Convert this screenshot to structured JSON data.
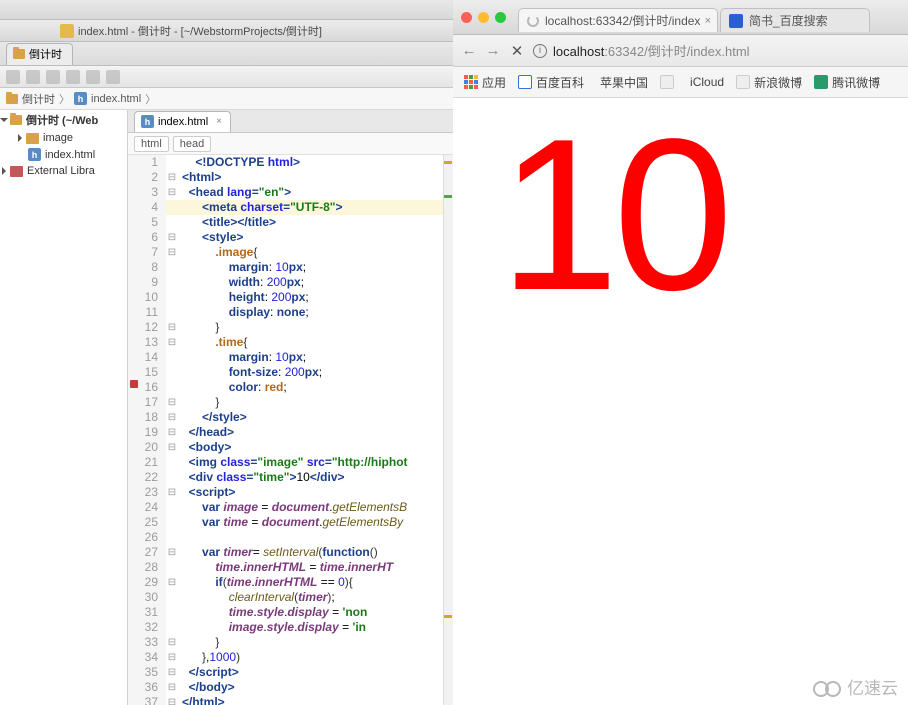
{
  "ide": {
    "title": "index.html - 倒计时 - [~/WebstormProjects/倒计时]",
    "project_tab": "倒计时",
    "breadcrumb": {
      "root": "倒计时",
      "file": "index.html"
    },
    "project_tree": {
      "root": "倒计时 (~/Web",
      "children": [
        {
          "name": "image",
          "type": "folder"
        },
        {
          "name": "index.html",
          "type": "html",
          "selected": true
        }
      ],
      "external": "External Libra"
    },
    "editor_tab": "index.html",
    "editor_crumb": [
      "html",
      "head"
    ],
    "code_lines": [
      {
        "n": 1,
        "f": "",
        "t": [
          [
            "",
            "    "
          ],
          [
            "tag",
            "<!DOCTYPE "
          ],
          [
            "attr",
            "html"
          ],
          [
            "tag",
            ">"
          ]
        ]
      },
      {
        "n": 2,
        "f": "⊟",
        "t": [
          [
            "tag",
            "<html>"
          ]
        ]
      },
      {
        "n": 3,
        "f": "⊟",
        "t": [
          [
            "",
            "  "
          ],
          [
            "tag",
            "<head "
          ],
          [
            "attr",
            "lang"
          ],
          [
            "tag",
            "="
          ],
          [
            "str",
            "\"en\""
          ],
          [
            "tag",
            ">"
          ]
        ]
      },
      {
        "n": 4,
        "f": "",
        "hl": true,
        "t": [
          [
            "",
            "      "
          ],
          [
            "tag",
            "<meta "
          ],
          [
            "attr",
            "charset"
          ],
          [
            "tag",
            "="
          ],
          [
            "str",
            "\"UTF-8\""
          ],
          [
            "tag",
            ">"
          ]
        ]
      },
      {
        "n": 5,
        "f": "",
        "t": [
          [
            "",
            "      "
          ],
          [
            "tag",
            "<title></title>"
          ]
        ]
      },
      {
        "n": 6,
        "f": "⊟",
        "t": [
          [
            "",
            "      "
          ],
          [
            "tag",
            "<style>"
          ]
        ]
      },
      {
        "n": 7,
        "f": "⊟",
        "t": [
          [
            "",
            "          "
          ],
          [
            "sel",
            ".image"
          ],
          [
            "br",
            "{"
          ]
        ]
      },
      {
        "n": 8,
        "f": "",
        "t": [
          [
            "",
            "              "
          ],
          [
            "prop",
            "margin"
          ],
          [
            "",
            ": "
          ],
          [
            "num",
            "10"
          ],
          [
            "prop",
            "px"
          ],
          [
            "",
            ";"
          ]
        ]
      },
      {
        "n": 9,
        "f": "",
        "t": [
          [
            "",
            "              "
          ],
          [
            "prop",
            "width"
          ],
          [
            "",
            ": "
          ],
          [
            "num",
            "200"
          ],
          [
            "prop",
            "px"
          ],
          [
            "",
            ";"
          ]
        ]
      },
      {
        "n": 10,
        "f": "",
        "t": [
          [
            "",
            "              "
          ],
          [
            "prop",
            "height"
          ],
          [
            "",
            ": "
          ],
          [
            "num",
            "200"
          ],
          [
            "prop",
            "px"
          ],
          [
            "",
            ";"
          ]
        ]
      },
      {
        "n": 11,
        "f": "",
        "t": [
          [
            "",
            "              "
          ],
          [
            "prop",
            "display"
          ],
          [
            "",
            ": "
          ],
          [
            "kw",
            "none"
          ],
          [
            "",
            ";"
          ]
        ]
      },
      {
        "n": 12,
        "f": "⊟",
        "t": [
          [
            "",
            "          "
          ],
          [
            "br",
            "}"
          ]
        ]
      },
      {
        "n": 13,
        "f": "⊟",
        "t": [
          [
            "",
            "          "
          ],
          [
            "sel",
            ".time"
          ],
          [
            "br",
            "{"
          ]
        ]
      },
      {
        "n": 14,
        "f": "",
        "t": [
          [
            "",
            "              "
          ],
          [
            "prop",
            "margin"
          ],
          [
            "",
            ": "
          ],
          [
            "num",
            "10"
          ],
          [
            "prop",
            "px"
          ],
          [
            "",
            ";"
          ]
        ]
      },
      {
        "n": 15,
        "f": "",
        "t": [
          [
            "",
            "              "
          ],
          [
            "prop",
            "font-size"
          ],
          [
            "",
            ": "
          ],
          [
            "num",
            "200"
          ],
          [
            "prop",
            "px"
          ],
          [
            "",
            ";"
          ]
        ]
      },
      {
        "n": 16,
        "f": "",
        "bp": true,
        "t": [
          [
            "",
            "              "
          ],
          [
            "prop",
            "color"
          ],
          [
            "",
            ": "
          ],
          [
            "sel",
            "red"
          ],
          [
            "",
            ";"
          ]
        ]
      },
      {
        "n": 17,
        "f": "⊟",
        "t": [
          [
            "",
            "          "
          ],
          [
            "br",
            "}"
          ]
        ]
      },
      {
        "n": 18,
        "f": "⊟",
        "t": [
          [
            "",
            "      "
          ],
          [
            "tag",
            "</style>"
          ]
        ]
      },
      {
        "n": 19,
        "f": "⊟",
        "t": [
          [
            "",
            "  "
          ],
          [
            "tag",
            "</head>"
          ]
        ]
      },
      {
        "n": 20,
        "f": "⊟",
        "t": [
          [
            "",
            "  "
          ],
          [
            "tag",
            "<body>"
          ]
        ]
      },
      {
        "n": 21,
        "f": "",
        "t": [
          [
            "",
            "  "
          ],
          [
            "tag",
            "<img "
          ],
          [
            "attr",
            "class"
          ],
          [
            "tag",
            "="
          ],
          [
            "str",
            "\"image\""
          ],
          [
            "tag",
            " "
          ],
          [
            "attr",
            "src"
          ],
          [
            "tag",
            "="
          ],
          [
            "str",
            "\"http://hiphot"
          ]
        ]
      },
      {
        "n": 22,
        "f": "",
        "t": [
          [
            "",
            "  "
          ],
          [
            "tag",
            "<div "
          ],
          [
            "attr",
            "class"
          ],
          [
            "tag",
            "="
          ],
          [
            "str",
            "\"time\""
          ],
          [
            "tag",
            ">"
          ],
          [
            "",
            "10"
          ],
          [
            "tag",
            "</div>"
          ]
        ]
      },
      {
        "n": 23,
        "f": "⊟",
        "t": [
          [
            "",
            "  "
          ],
          [
            "tag",
            "<script>"
          ]
        ]
      },
      {
        "n": 24,
        "f": "",
        "t": [
          [
            "",
            "      "
          ],
          [
            "kw",
            "var "
          ],
          [
            "var",
            "image"
          ],
          [
            "",
            ""
          ],
          [
            "",
            " = "
          ],
          [
            "var",
            "document"
          ],
          [
            "",
            "."
          ],
          [
            "fn",
            "getElementsB"
          ]
        ]
      },
      {
        "n": 25,
        "f": "",
        "t": [
          [
            "",
            "      "
          ],
          [
            "kw",
            "var "
          ],
          [
            "var",
            "time"
          ],
          [
            "",
            " = "
          ],
          [
            "var",
            "document"
          ],
          [
            "",
            "."
          ],
          [
            "fn",
            "getElementsBy"
          ]
        ]
      },
      {
        "n": 26,
        "f": "",
        "t": [
          [
            "",
            ""
          ]
        ]
      },
      {
        "n": 27,
        "f": "⊟",
        "t": [
          [
            "",
            "      "
          ],
          [
            "kw",
            "var "
          ],
          [
            "var",
            "timer"
          ],
          [
            "",
            "= "
          ],
          [
            "fn",
            "setInterval"
          ],
          [
            "br",
            "("
          ],
          [
            "kw",
            "function"
          ],
          [
            "br",
            "()"
          ]
        ]
      },
      {
        "n": 28,
        "f": "",
        "t": [
          [
            "",
            "          "
          ],
          [
            "var",
            "time"
          ],
          [
            "",
            "."
          ],
          [
            "var",
            "innerHTML"
          ],
          [
            "",
            " = "
          ],
          [
            "var",
            "time"
          ],
          [
            "",
            "."
          ],
          [
            "var",
            "innerHT"
          ]
        ]
      },
      {
        "n": 29,
        "f": "⊟",
        "t": [
          [
            "",
            "          "
          ],
          [
            "kw",
            "if"
          ],
          [
            "br",
            "("
          ],
          [
            "var",
            "time"
          ],
          [
            "",
            "."
          ],
          [
            "var",
            "innerHTML"
          ],
          [
            "",
            " == "
          ],
          [
            "num",
            "0"
          ],
          [
            "br",
            ")"
          ],
          [
            "br",
            "{"
          ]
        ]
      },
      {
        "n": 30,
        "f": "",
        "t": [
          [
            "",
            "              "
          ],
          [
            "fn",
            "clearInterval"
          ],
          [
            "br",
            "("
          ],
          [
            "var",
            "timer"
          ],
          [
            "br",
            ")"
          ],
          [
            "",
            ";"
          ]
        ]
      },
      {
        "n": 31,
        "f": "",
        "t": [
          [
            "",
            "              "
          ],
          [
            "var",
            "time"
          ],
          [
            "",
            "."
          ],
          [
            "var",
            "style"
          ],
          [
            "",
            "."
          ],
          [
            "var",
            "display"
          ],
          [
            "",
            " = "
          ],
          [
            "str",
            "'non"
          ]
        ]
      },
      {
        "n": 32,
        "f": "",
        "t": [
          [
            "",
            "              "
          ],
          [
            "var",
            "image"
          ],
          [
            "",
            "."
          ],
          [
            "var",
            "style"
          ],
          [
            "",
            "."
          ],
          [
            "var",
            "display"
          ],
          [
            "",
            " = "
          ],
          [
            "str",
            "'in"
          ]
        ]
      },
      {
        "n": 33,
        "f": "⊟",
        "t": [
          [
            "",
            "          "
          ],
          [
            "br",
            "}"
          ]
        ]
      },
      {
        "n": 34,
        "f": "⊟",
        "t": [
          [
            "",
            "      "
          ],
          [
            "br",
            "}"
          ],
          [
            "",
            ","
          ],
          [
            "num",
            "1000"
          ],
          [
            "br",
            ")"
          ]
        ]
      },
      {
        "n": 35,
        "f": "⊟",
        "t": [
          [
            "",
            "  "
          ],
          [
            "tag",
            "</script>"
          ]
        ]
      },
      {
        "n": 36,
        "f": "⊟",
        "t": [
          [
            "",
            "  "
          ],
          [
            "tag",
            "</body>"
          ]
        ]
      },
      {
        "n": 37,
        "f": "⊟",
        "t": [
          [
            "tag",
            "</html>"
          ]
        ]
      }
    ]
  },
  "browser": {
    "tabs": [
      {
        "title": "localhost:63342/倒计时/index",
        "loading": true
      },
      {
        "title": "简书_百度搜索",
        "favicon": "#2a5fd4"
      }
    ],
    "url": {
      "host": "localhost",
      "port": ":63342",
      "path": "/倒计时/index.html"
    },
    "bookmarks": [
      {
        "label": "应用",
        "apps": true
      },
      {
        "label": "百度百科",
        "color": "#3a6fd8"
      },
      {
        "label": "苹果中国",
        "color": "#444",
        "apple": true
      },
      {
        "label": "",
        "color": "#999"
      },
      {
        "label": "iCloud",
        "color": "#444",
        "apple": true
      },
      {
        "label": "新浪微博",
        "color": "#999"
      },
      {
        "label": "腾讯微博",
        "color": "#2a9a6a"
      }
    ],
    "countdown": "10"
  },
  "watermark": "亿速云"
}
